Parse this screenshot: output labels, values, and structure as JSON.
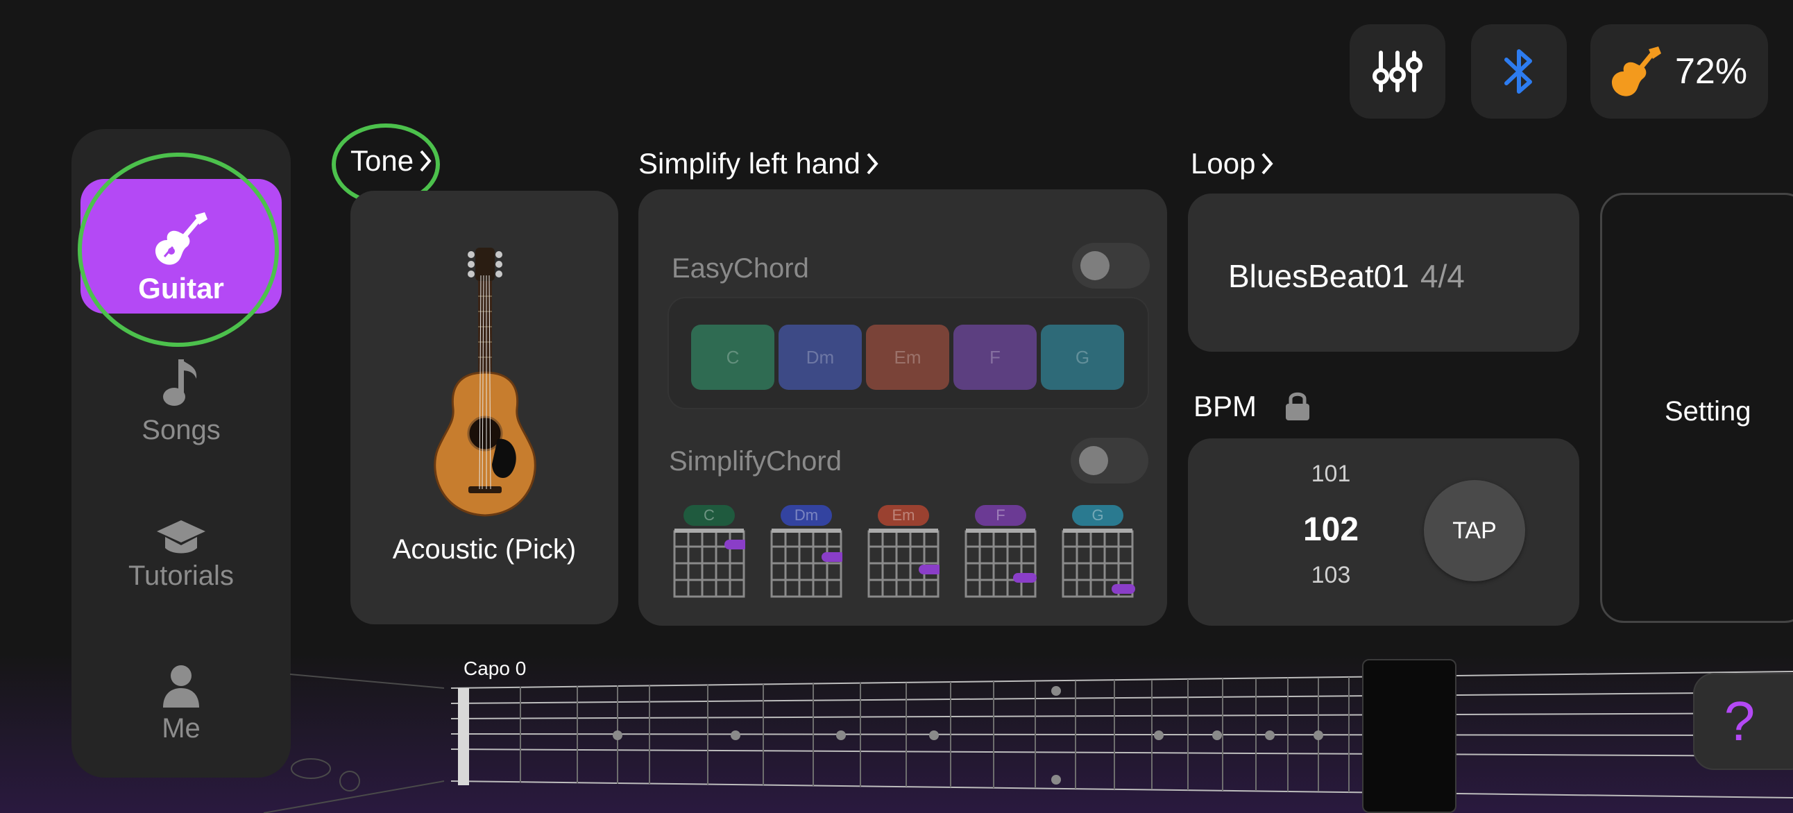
{
  "app": {
    "accent_color": "#b449f5",
    "highlight_color": "#4cc14c"
  },
  "top_bar": {
    "mixer_icon": "sliders-icon",
    "bluetooth_icon": "bluetooth-icon",
    "battery_icon": "guitar-battery-icon",
    "battery_percent": "72%"
  },
  "sidebar": {
    "items": [
      {
        "label": "Guitar",
        "icon": "electric-guitar-icon",
        "active": true
      },
      {
        "label": "Songs",
        "icon": "music-note-icon",
        "active": false
      },
      {
        "label": "Tutorials",
        "icon": "graduation-cap-icon",
        "active": false
      },
      {
        "label": "Me",
        "icon": "person-icon",
        "active": false
      }
    ]
  },
  "tone": {
    "title": "Tone",
    "name": "Acoustic (Pick)"
  },
  "simplify": {
    "title": "Simplify left hand",
    "easy_chord_label": "EasyChord",
    "easy_chord_on": false,
    "simplify_chord_label": "SimplifyChord",
    "simplify_chord_on": false,
    "chords": [
      {
        "name": "C",
        "color": "#2f6b52",
        "tag_color": "#1f5a3e"
      },
      {
        "name": "Dm",
        "color": "#3d4a86",
        "tag_color": "#3343a0"
      },
      {
        "name": "Em",
        "color": "#7a4338",
        "tag_color": "#9a4130"
      },
      {
        "name": "F",
        "color": "#5c3f80",
        "tag_color": "#6b3a94"
      },
      {
        "name": "G",
        "color": "#2e6a78",
        "tag_color": "#2a7a90"
      }
    ]
  },
  "loop": {
    "title": "Loop",
    "name": "BluesBeat01",
    "time_signature": "4/4"
  },
  "bpm": {
    "label": "BPM",
    "prev": "101",
    "current": "102",
    "next": "103",
    "tap_label": "TAP",
    "locked": true
  },
  "setting": {
    "label": "Setting"
  },
  "fretboard": {
    "capo_label": "Capo 0"
  },
  "help": {
    "label": "?"
  }
}
